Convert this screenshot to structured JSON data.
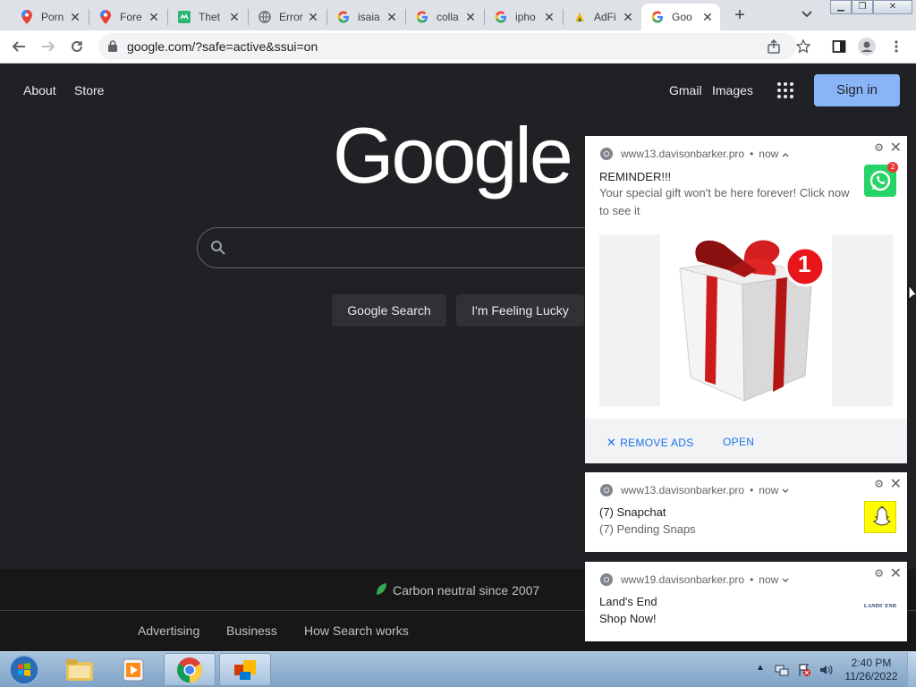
{
  "browser": {
    "tabs": [
      {
        "title": "Porn",
        "icon": "google-maps-pin-icon"
      },
      {
        "title": "Fore",
        "icon": "google-maps-pin-icon"
      },
      {
        "title": "Thet",
        "icon": "green-square-icon"
      },
      {
        "title": "Error",
        "icon": "globe-icon"
      },
      {
        "title": "isaia",
        "icon": "google-g-icon"
      },
      {
        "title": "colla",
        "icon": "google-g-icon"
      },
      {
        "title": "ipho",
        "icon": "google-g-icon"
      },
      {
        "title": "AdFi",
        "icon": "adfi-icon"
      },
      {
        "title": "Goo",
        "icon": "google-g-icon",
        "active": true
      }
    ],
    "url": "google.com/?safe=active&ssui=on"
  },
  "google": {
    "top_left": [
      "About",
      "Store"
    ],
    "top_right": [
      "Gmail",
      "Images"
    ],
    "sign_in": "Sign in",
    "logo": "Google",
    "buttons": [
      "Google Search",
      "I'm Feeling Lucky"
    ],
    "carbon": "Carbon neutral since 2007",
    "footer_links": [
      "Advertising",
      "Business",
      "How Search works"
    ]
  },
  "notifications": [
    {
      "source": "www13.davisonbarker.pro",
      "time": "now",
      "title": "REMINDER!!!",
      "body": "Your special gift won't be here forever! Click now to see it",
      "badge": "2",
      "image_badge": "1",
      "actions": [
        "REMOVE ADS",
        "OPEN"
      ]
    },
    {
      "source": "www13.davisonbarker.pro",
      "time": "now",
      "title": "(7) Snapchat",
      "body": "(7) Pending Snaps"
    },
    {
      "source": "www19.davisonbarker.pro",
      "time": "now",
      "title": "Land's End",
      "body": "Shop Now!",
      "thumb_text": "LANDS' END"
    }
  ],
  "taskbar": {
    "time": "2:40 PM",
    "date": "11/26/2022"
  },
  "colors": {
    "page_bg": "#202124",
    "sign_in_bg": "#8ab4f8",
    "notif_link": "#1a73e8",
    "gift_ribbon": "#cc1b1b",
    "whatsapp": "#25d366",
    "snapchat": "#fffc00"
  }
}
